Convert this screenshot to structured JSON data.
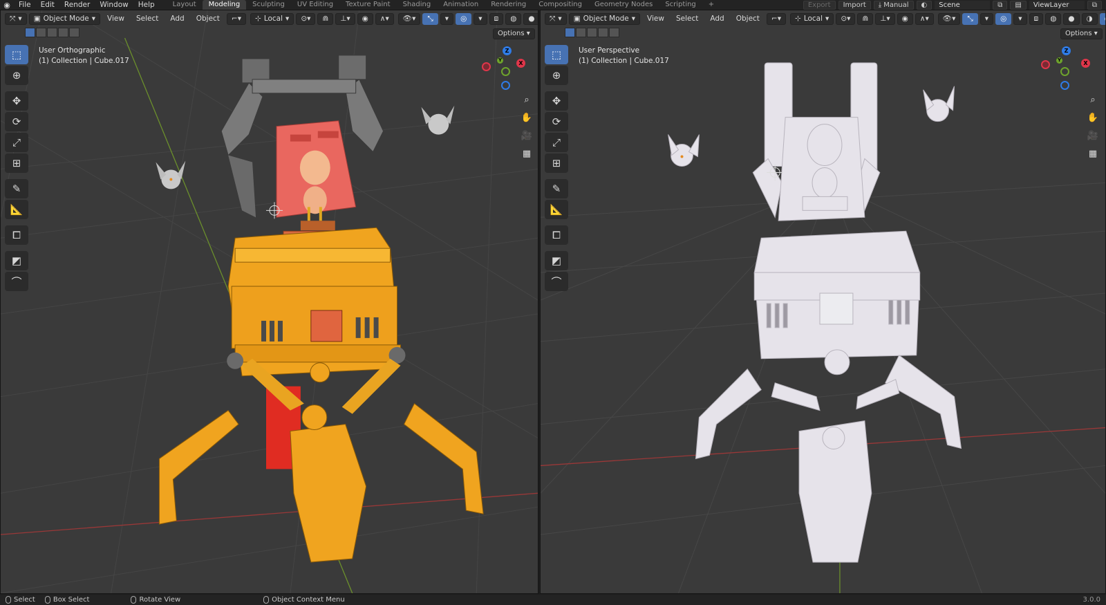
{
  "menu": [
    "File",
    "Edit",
    "Render",
    "Window",
    "Help"
  ],
  "workspaces": [
    "Layout",
    "Modeling",
    "Sculpting",
    "UV Editing",
    "Texture Paint",
    "Shading",
    "Animation",
    "Rendering",
    "Compositing",
    "Geometry Nodes",
    "Scripting",
    "+"
  ],
  "active_workspace": "Modeling",
  "topright": {
    "export": "Export",
    "import": "Import",
    "manual": "Manual",
    "scene": "Scene",
    "view_layer": "ViewLayer"
  },
  "viewports": {
    "left": {
      "mode": "Object Mode",
      "view": "View",
      "select": "Select",
      "add": "Add",
      "object": "Object",
      "transform": "Local",
      "options": "Options",
      "view_name": "User Orthographic",
      "collection": "(1) Collection | Cube.017",
      "shading": "material"
    },
    "right": {
      "mode": "Object Mode",
      "view": "View",
      "select": "Select",
      "add": "Add",
      "object": "Object",
      "transform": "Local",
      "options": "Options",
      "view_name": "User Perspective",
      "collection": "(1) Collection | Cube.017",
      "shading": "solid"
    }
  },
  "gizmo": {
    "z": "Z",
    "y": "Y",
    "x": "X",
    "z_color": "#2f7be6",
    "y_color": "#6ea32c",
    "x_color": "#e0364a"
  },
  "colors": {
    "accent": "#4772b3",
    "body_orange": "#f0a41f",
    "seat_red": "#e9675f",
    "clay": "#e6e3ea"
  },
  "statusbar": {
    "select": "Select",
    "box_select": "Box Select",
    "rotate_view": "Rotate View",
    "context_menu": "Object Context Menu",
    "version": "3.0.0"
  }
}
